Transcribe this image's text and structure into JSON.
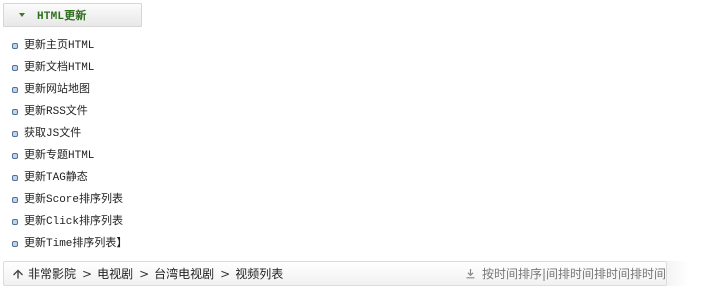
{
  "panel": {
    "title": "HTML更新",
    "items": [
      {
        "label": "更新主页HTML"
      },
      {
        "label": "更新文档HTML"
      },
      {
        "label": "更新网站地图"
      },
      {
        "label": "更新RSS文件"
      },
      {
        "label": "获取JS文件"
      },
      {
        "label": "更新专题HTML"
      },
      {
        "label": "更新TAG静态"
      },
      {
        "label": "更新Score排序列表"
      },
      {
        "label": "更新Click排序列表"
      },
      {
        "label": "更新Time排序列表】"
      }
    ]
  },
  "breadcrumb": {
    "separator": ">",
    "items": [
      {
        "label": "非常影院"
      },
      {
        "label": "电视剧"
      },
      {
        "label": "台湾电视剧"
      },
      {
        "label": "视频列表"
      }
    ],
    "sort_text": "按时间排序|间排时间排时间排时间排序"
  },
  "colors": {
    "panel_title": "#2e6f1e",
    "bullet_border": "#4d6f9c",
    "bullet_fill": "#c3d5ea",
    "sort_text": "#777777"
  },
  "icons": {
    "panel_toggle": "chevron-down-icon",
    "bullet": "square-bullet-icon",
    "home": "home-icon",
    "download": "download-icon"
  }
}
